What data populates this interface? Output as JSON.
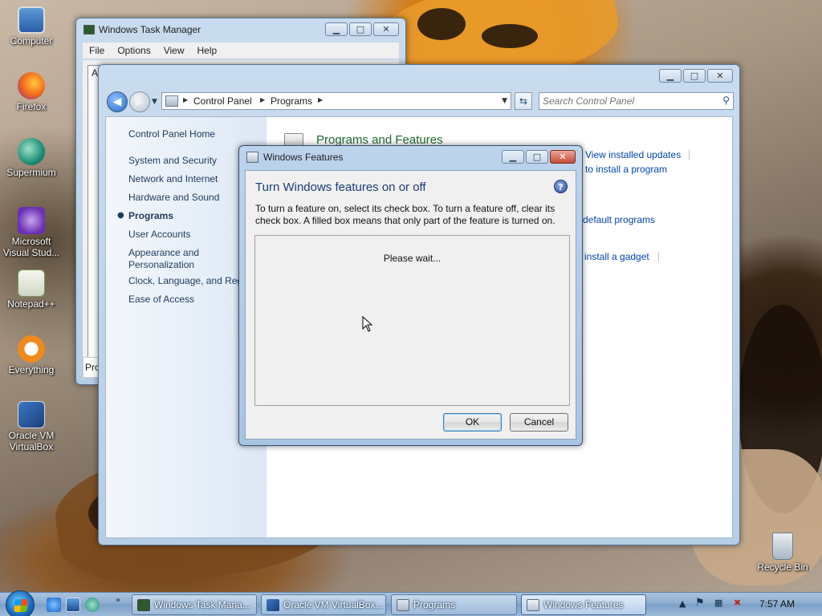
{
  "desktop": {
    "icons": [
      {
        "label": "Computer",
        "icon": "computer-icon"
      },
      {
        "label": "Firefox",
        "icon": "firefox-icon"
      },
      {
        "label": "Supermium",
        "icon": "supermium-icon"
      },
      {
        "label": "Microsoft Visual Stud...",
        "icon": "visual-studio-icon"
      },
      {
        "label": "Notepad++",
        "icon": "notepad-plus-plus-icon"
      },
      {
        "label": "Everything",
        "icon": "everything-icon"
      },
      {
        "label": "Oracle VM VirtualBox",
        "icon": "virtualbox-icon"
      },
      {
        "label": "Recycle Bin",
        "icon": "recycle-bin-icon"
      }
    ]
  },
  "task_manager": {
    "title": "Windows Task Manager",
    "menu": [
      "File",
      "Options",
      "View",
      "Help"
    ],
    "tab_stub": "A",
    "status_stub": "Pro"
  },
  "control_panel": {
    "breadcrumb": [
      "Control Panel",
      "Programs"
    ],
    "search_placeholder": "Search Control Panel",
    "nav": {
      "home": "Control Panel Home",
      "items": [
        "System and Security",
        "Network and Internet",
        "Hardware and Sound",
        "Programs",
        "User Accounts",
        "Appearance and Personalization",
        "Clock, Language, and Reg",
        "Ease of Access"
      ],
      "current": "Programs"
    },
    "main": {
      "section_title": "Programs and Features",
      "links": [
        "View installed updates",
        "to install a program",
        "default programs",
        "install a gadget"
      ]
    }
  },
  "windows_features": {
    "title": "Windows Features",
    "heading": "Turn Windows features on or off",
    "description": "To turn a feature on, select its check box. To turn a feature off, clear its check box. A filled box means that only part of the feature is turned on.",
    "status": "Please wait...",
    "ok_label": "OK",
    "cancel_label": "Cancel"
  },
  "taskbar": {
    "buttons": [
      {
        "label": "Windows Task Mana...",
        "icon": "task-manager-icon"
      },
      {
        "label": "Oracle VM VirtualBox...",
        "icon": "virtualbox-icon"
      },
      {
        "label": "Programs",
        "icon": "control-panel-icon"
      },
      {
        "label": "Windows Features",
        "icon": "windows-features-icon",
        "active": true
      }
    ],
    "clock": "7:57 AM"
  },
  "colors": {
    "link": "#0645ad",
    "section_title": "#1e6b2e",
    "dialog_heading": "#1c3c78",
    "titlebar": "#b6cde6"
  }
}
